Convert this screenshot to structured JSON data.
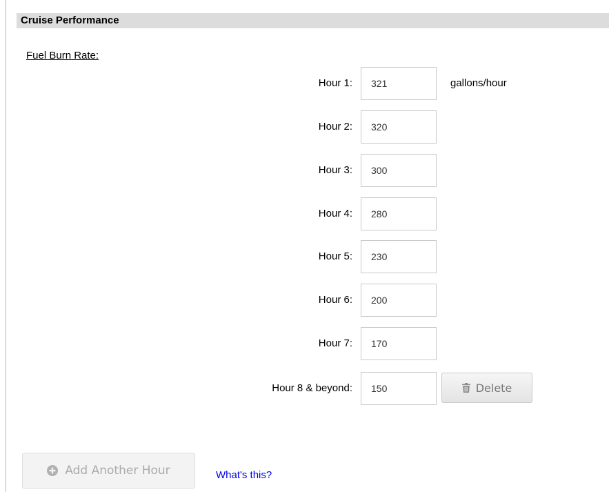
{
  "section": {
    "title": "Cruise Performance"
  },
  "fuel_burn": {
    "title": "Fuel Burn Rate:",
    "unit": "gallons/hour",
    "hours": [
      {
        "label": "Hour 1:",
        "value": "321"
      },
      {
        "label": "Hour 2:",
        "value": "320"
      },
      {
        "label": "Hour 3:",
        "value": "300"
      },
      {
        "label": "Hour 4:",
        "value": "280"
      },
      {
        "label": "Hour 5:",
        "value": "230"
      },
      {
        "label": "Hour 6:",
        "value": "200"
      },
      {
        "label": "Hour 7:",
        "value": "170"
      },
      {
        "label": "Hour 8 & beyond:",
        "value": "150"
      }
    ],
    "delete_label": "Delete"
  },
  "actions": {
    "add_hour_label": "Add Another Hour",
    "whats_this_label": "What's this?"
  },
  "icons": {
    "delete": "trash-icon",
    "add": "plus-circle-icon"
  },
  "colors": {
    "header_bg": "#dcdcdc",
    "link": "#0000ee",
    "disabled_text": "#aaaaaa"
  }
}
